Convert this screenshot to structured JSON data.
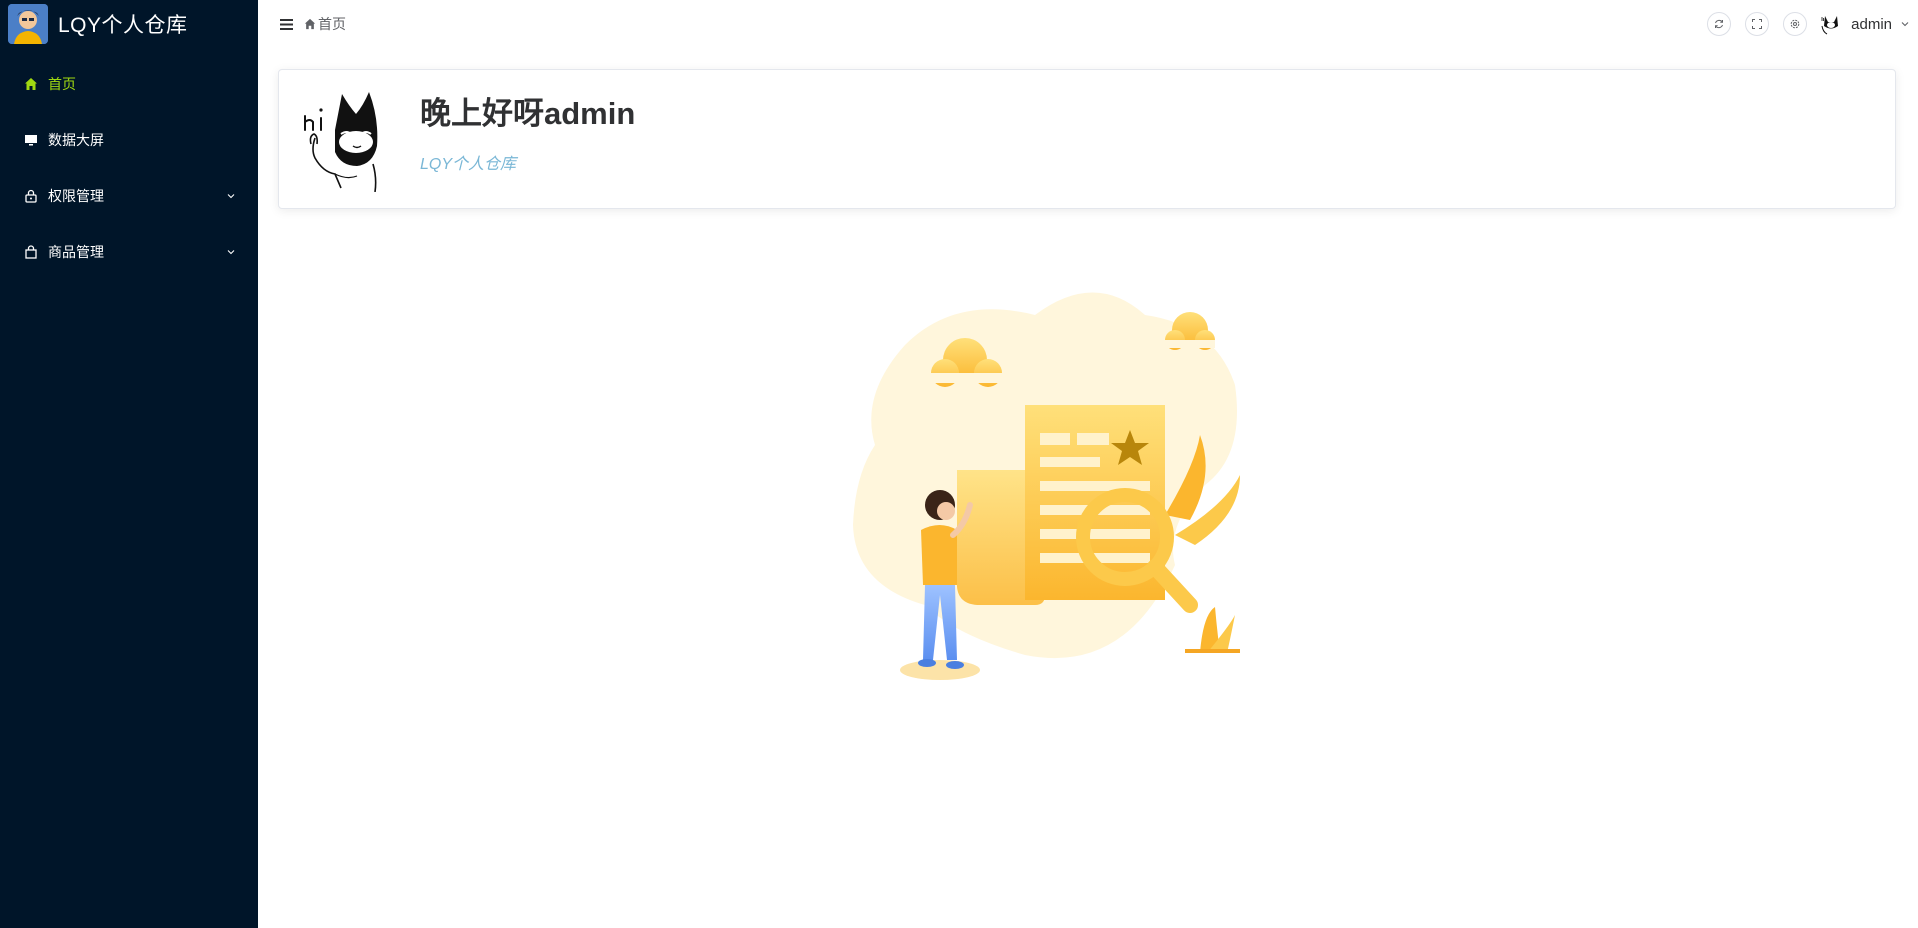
{
  "app": {
    "title": "LQY个人仓库"
  },
  "sidebar": {
    "items": [
      {
        "label": "首页",
        "icon": "home-icon",
        "active": true
      },
      {
        "label": "数据大屏",
        "icon": "monitor-icon",
        "active": false
      },
      {
        "label": "权限管理",
        "icon": "lock-icon",
        "active": false,
        "expandable": true
      },
      {
        "label": "商品管理",
        "icon": "shopping-bag-icon",
        "active": false,
        "expandable": true
      }
    ]
  },
  "header": {
    "breadcrumb": "首页",
    "username": "admin",
    "actions": [
      "refresh-icon",
      "fullscreen-icon",
      "settings-icon"
    ]
  },
  "welcome": {
    "greeting": "晚上好呀admin",
    "subtitle": "LQY个人仓库"
  },
  "colors": {
    "sidebar_bg": "#001529",
    "active_menu": "#a0d911",
    "subtitle": "#7ab7d6",
    "illustration_accent": "#fbb62e"
  }
}
